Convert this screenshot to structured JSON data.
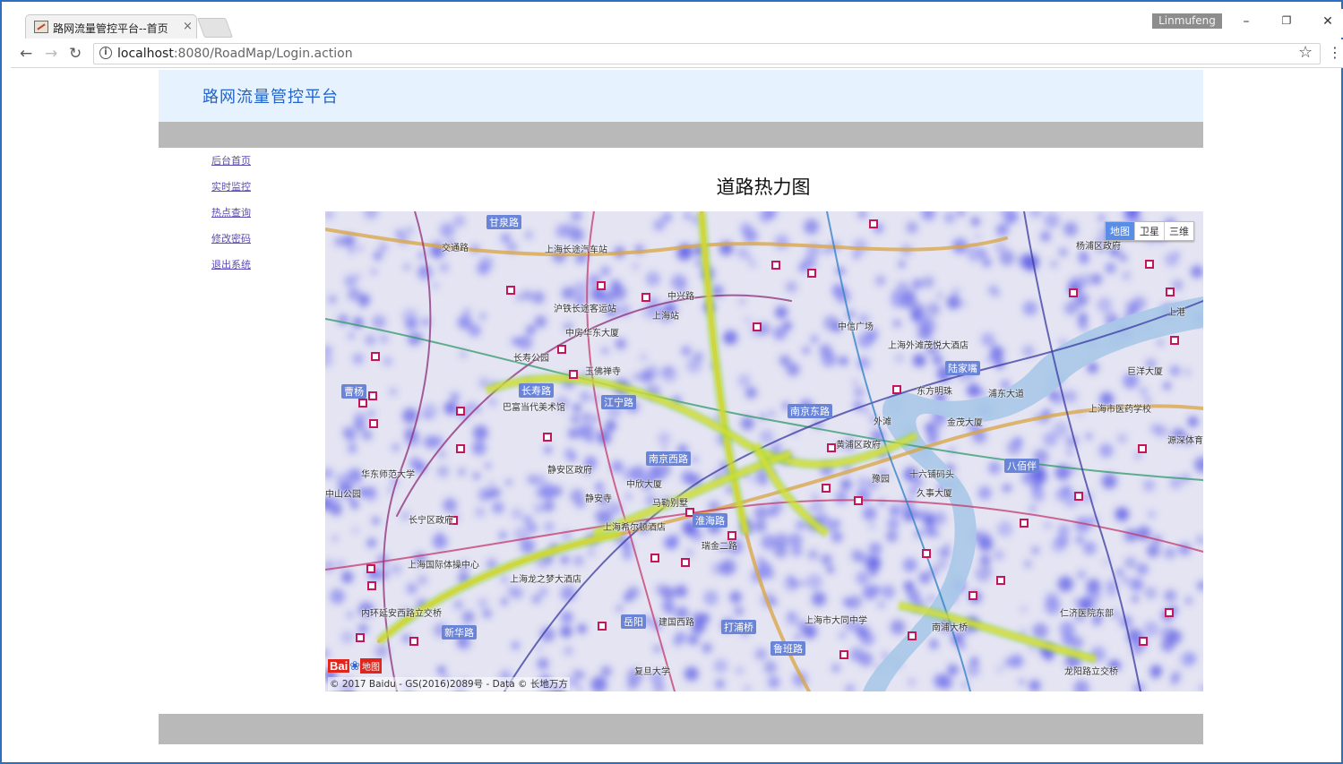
{
  "browser": {
    "tab_title": "路网流量管控平台--首页",
    "tab_close": "×",
    "user_badge": "Linmufeng",
    "url_host": "localhost",
    "url_rest": ":8080/RoadMap/Login.action",
    "window_controls": {
      "minimize": "–",
      "restore": "❐",
      "close": "✕"
    },
    "nav_icons": {
      "back": "back-arrow-icon",
      "forward": "forward-arrow-icon",
      "reload": "reload-icon",
      "info": "info-icon",
      "star": "bookmark-star-icon",
      "menu": "kebab-menu-icon"
    }
  },
  "header": {
    "brand": "路网流量管控平台"
  },
  "sidebar": {
    "items": [
      {
        "label": "后台首页"
      },
      {
        "label": "实时监控"
      },
      {
        "label": "热点查询"
      },
      {
        "label": "修改密码"
      },
      {
        "label": "退出系统"
      }
    ]
  },
  "main": {
    "title": "道路热力图"
  },
  "map": {
    "type_buttons": [
      {
        "label": "地图"
      },
      {
        "label": "卫星"
      },
      {
        "label": "三维"
      }
    ],
    "logo_text": "Bai",
    "logo_suffix": "地图",
    "copyright": "© 2017 Baidu - GS(2016)2089号 - Data © 长地万方",
    "labels": [
      "甘泉路",
      "交通路",
      "上海长途汽车站",
      "中兴路",
      "沪铁长途客运站",
      "上海站",
      "中房华东大厦",
      "长寿公园",
      "玉佛禅寺",
      "长寿路",
      "江宁路",
      "巴富当代美术馆",
      "南京东路",
      "陆家嘴",
      "东方明珠",
      "金茂大厦",
      "上海市医药学校",
      "浦东大道",
      "八佰伴",
      "南京西路",
      "静安区政府",
      "中欣大厦",
      "静安寺",
      "马勒别墅",
      "上海希尔顿酒店",
      "淮海路",
      "瑞金二路",
      "上海国际体操中心",
      "上海龙之梦大酒店",
      "长宁区政府",
      "上海市大同中学",
      "南浦大桥",
      "鲁班路",
      "新华路",
      "岳阳",
      "打浦桥",
      "建国西路",
      "复旦大学",
      "龙阳路立交桥",
      "华东师范大学",
      "中信广场",
      "上海外滩茂悦大酒店",
      "外滩",
      "黄浦区政府",
      "豫园",
      "十六铺码头",
      "久事大厦",
      "杨浦区政府",
      "上港",
      "巨洋大厦",
      "源深体育中心",
      "仁济医院东部",
      "内环延安西路立交桥",
      "曹杨",
      "中山公园"
    ]
  },
  "colors": {
    "header_bg": "#e6f3ff",
    "brand": "#2463c7",
    "bar_gray": "#b9b9b9",
    "link": "#5b4bb3",
    "window_border": "#2b6fc0",
    "heat_low": "#5a5ae6",
    "heat_mid": "#7fd34a",
    "heat_high": "#f2e21a"
  }
}
